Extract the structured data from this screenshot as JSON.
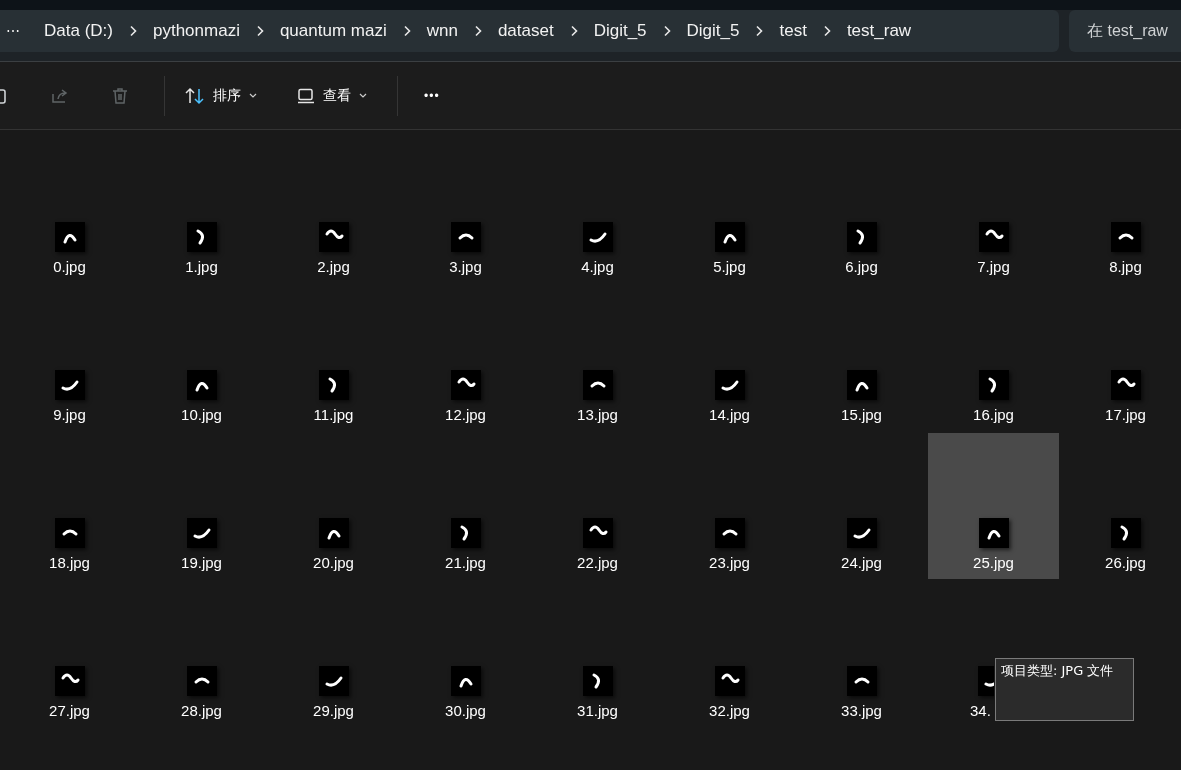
{
  "breadcrumb": {
    "overflow": "⋯",
    "items": [
      "Data (D:)",
      "pythonmazi",
      "quantum mazi",
      "wnn",
      "dataset",
      "Digit_5",
      "Digit_5",
      "test",
      "test_raw"
    ]
  },
  "search": {
    "placeholder": "在 test_raw"
  },
  "toolbar": {
    "buttons": [
      {
        "kind": "copy",
        "disabled": false
      },
      {
        "kind": "share",
        "disabled": true
      },
      {
        "kind": "delete",
        "disabled": true
      }
    ],
    "sort": {
      "label": "排序"
    },
    "view": {
      "label": "查看"
    },
    "more": "•••"
  },
  "files": [
    {
      "label": "0.jpg",
      "selected": false
    },
    {
      "label": "1.jpg",
      "selected": false
    },
    {
      "label": "2.jpg",
      "selected": false
    },
    {
      "label": "3.jpg",
      "selected": false
    },
    {
      "label": "4.jpg",
      "selected": false
    },
    {
      "label": "5.jpg",
      "selected": false
    },
    {
      "label": "6.jpg",
      "selected": false
    },
    {
      "label": "7.jpg",
      "selected": false
    },
    {
      "label": "8.jpg",
      "selected": false
    },
    {
      "label": "9.jpg",
      "selected": false
    },
    {
      "label": "10.jpg",
      "selected": false
    },
    {
      "label": "11.jpg",
      "selected": false
    },
    {
      "label": "12.jpg",
      "selected": false
    },
    {
      "label": "13.jpg",
      "selected": false
    },
    {
      "label": "14.jpg",
      "selected": false
    },
    {
      "label": "15.jpg",
      "selected": false
    },
    {
      "label": "16.jpg",
      "selected": false
    },
    {
      "label": "17.jpg",
      "selected": false
    },
    {
      "label": "18.jpg",
      "selected": false
    },
    {
      "label": "19.jpg",
      "selected": false
    },
    {
      "label": "20.jpg",
      "selected": false
    },
    {
      "label": "21.jpg",
      "selected": false
    },
    {
      "label": "22.jpg",
      "selected": false
    },
    {
      "label": "23.jpg",
      "selected": false
    },
    {
      "label": "24.jpg",
      "selected": false
    },
    {
      "label": "25.jpg",
      "selected": true
    },
    {
      "label": "26.jpg",
      "selected": false
    },
    {
      "label": "27.jpg",
      "selected": false
    },
    {
      "label": "28.jpg",
      "selected": false
    },
    {
      "label": "29.jpg",
      "selected": false
    },
    {
      "label": "30.jpg",
      "selected": false
    },
    {
      "label": "31.jpg",
      "selected": false
    },
    {
      "label": "32.jpg",
      "selected": false
    },
    {
      "label": "33.jpg",
      "selected": false
    },
    {
      "label": "34.",
      "selected": false
    }
  ],
  "tooltip": {
    "text": "项目类型: JPG 文件"
  }
}
